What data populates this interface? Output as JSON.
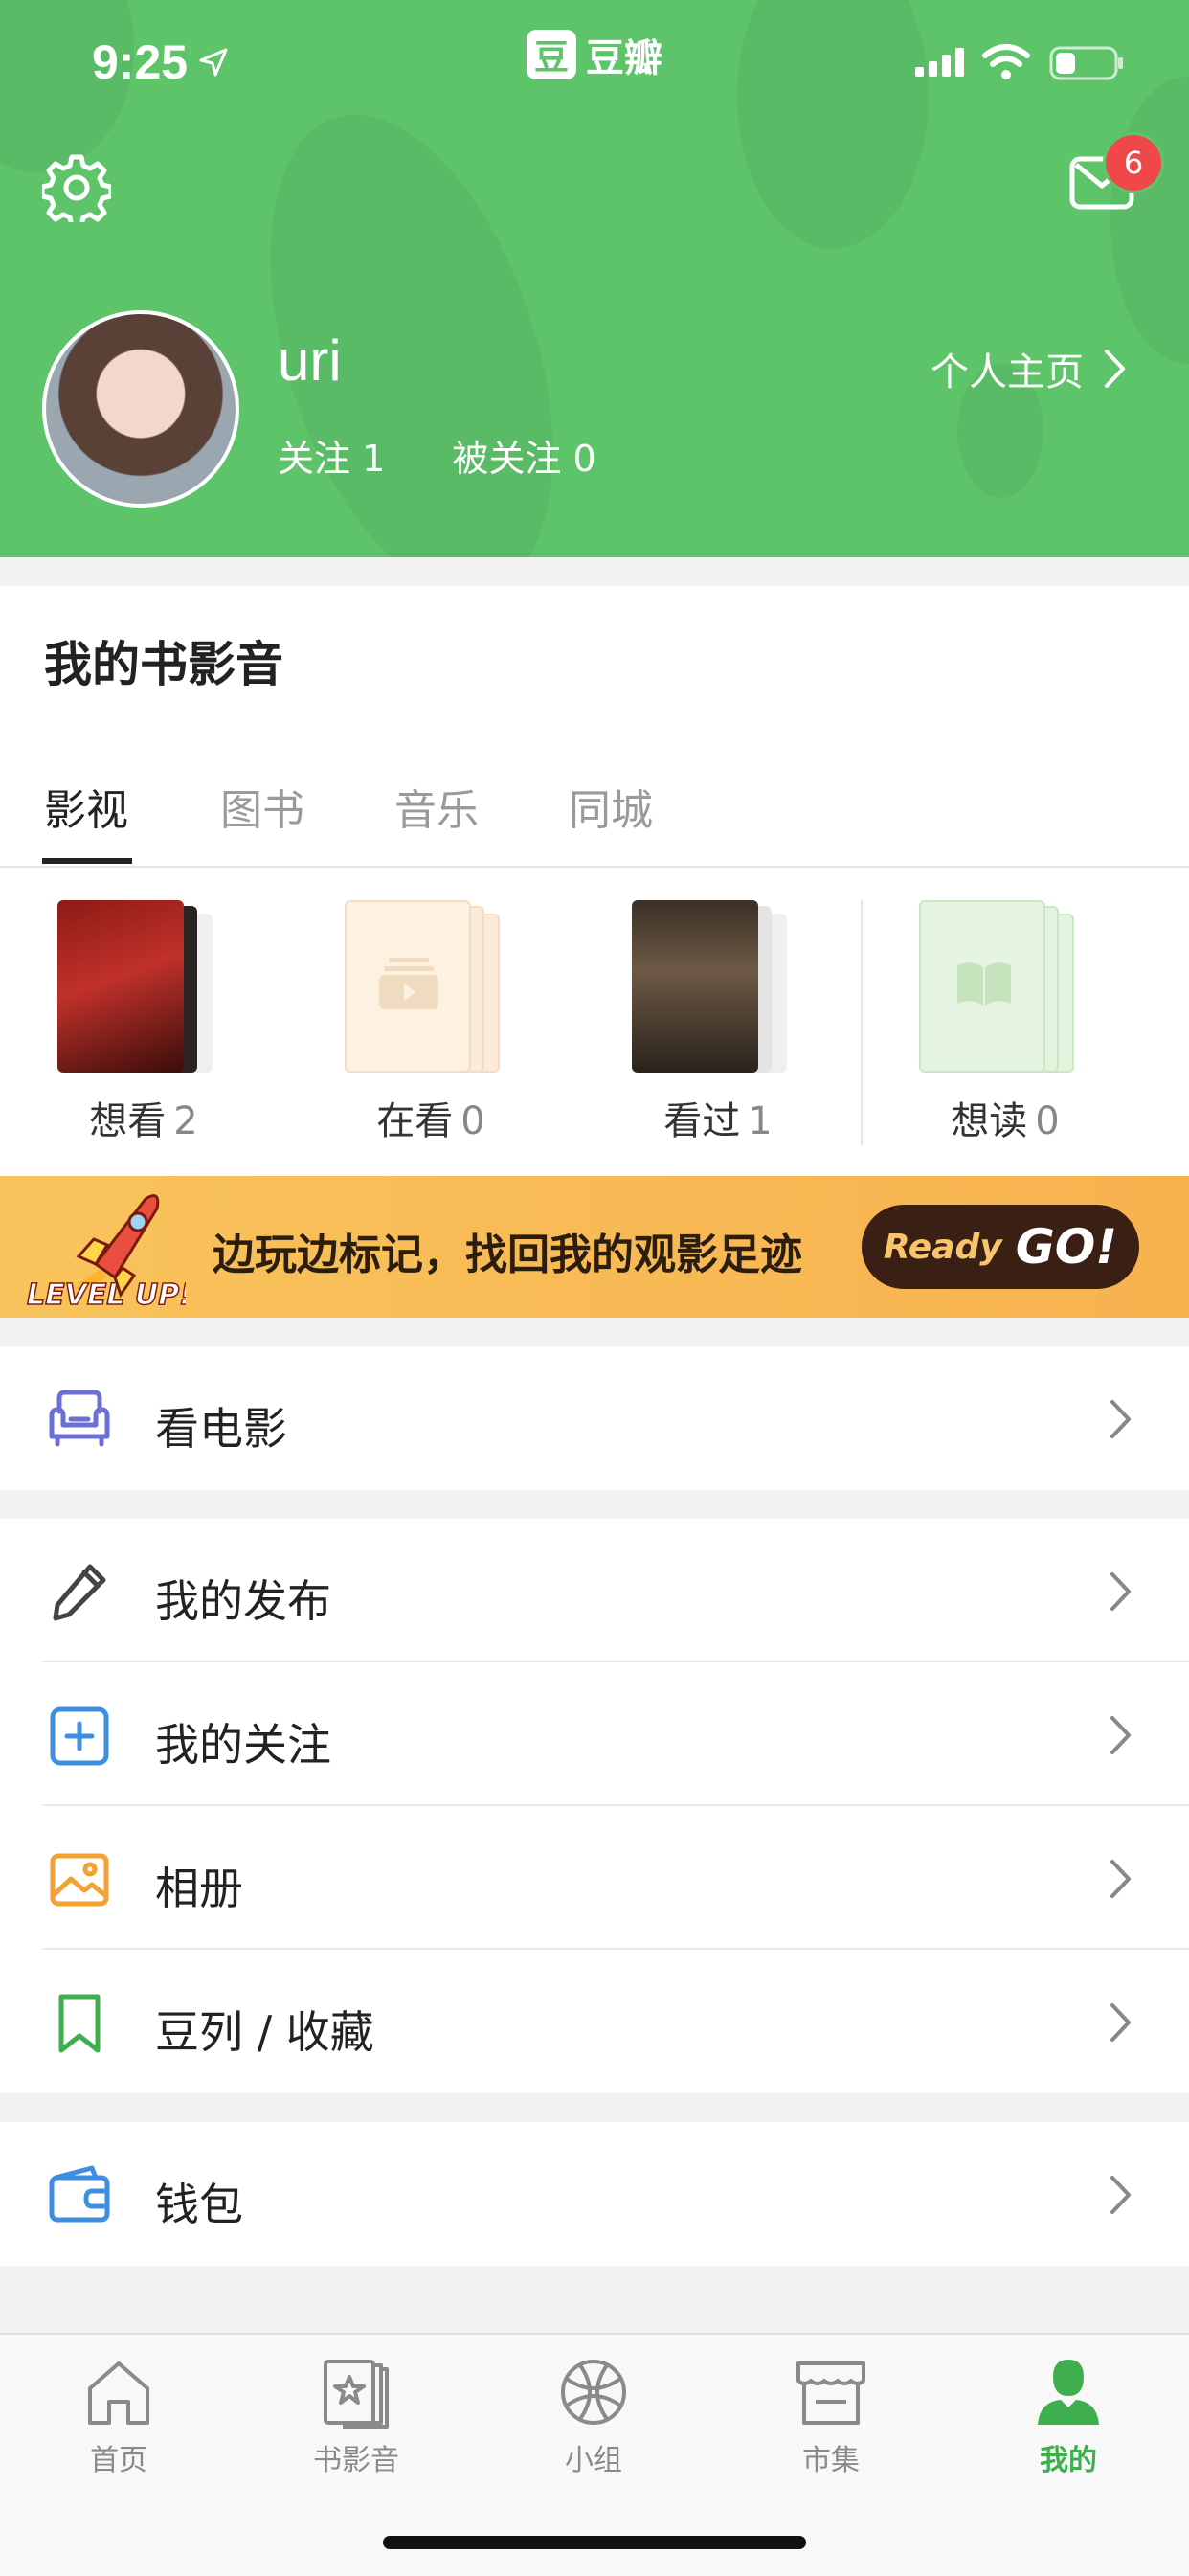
{
  "status_bar": {
    "time": "9:25",
    "brand_icon_char": "豆",
    "brand_name": "豆瓣",
    "battery_level": 0.35
  },
  "header": {
    "notification_count": "6",
    "username": "uri",
    "following": "关注 1",
    "followers": "被关注 0",
    "homepage_link": "个人主页"
  },
  "media": {
    "title": "我的书影音",
    "tabs": [
      "影视",
      "图书",
      "音乐",
      "同城"
    ],
    "active_tab": 0,
    "shelves": [
      {
        "label": "想看",
        "count": "2"
      },
      {
        "label": "在看",
        "count": "0"
      },
      {
        "label": "看过",
        "count": "1"
      },
      {
        "label": "想读",
        "count": "0"
      }
    ]
  },
  "banner": {
    "badge_text": "LEVEL UP!",
    "text": "边玩边标记，找回我的观影足迹",
    "button_ready": "Ready",
    "button_go": "GO!"
  },
  "menu": {
    "movies": "看电影",
    "my_posts": "我的发布",
    "my_follows": "我的关注",
    "album": "相册",
    "doulist": "豆列 / 收藏",
    "wallet": "钱包"
  },
  "tabbar": {
    "items": [
      "首页",
      "书影音",
      "小组",
      "市集",
      "我的"
    ],
    "active": 4
  },
  "colors": {
    "accent": "#5ec46a",
    "tab_active": "#3fae4f",
    "badge": "#f0474a",
    "banner": "#f8bb55"
  }
}
